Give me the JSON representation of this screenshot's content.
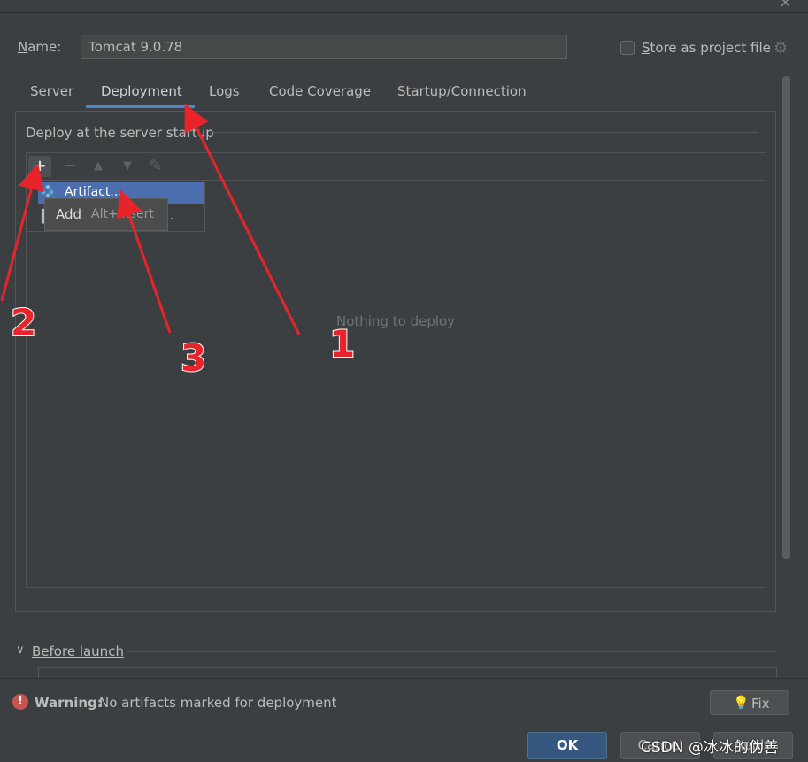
{
  "header": {
    "name_label_letter": "N",
    "name_label_rest": "ame:",
    "name_value": "Tomcat 9.0.78",
    "store_label_letter": "S",
    "store_label_rest": "tore as project file",
    "store_checked": false
  },
  "tabs": [
    {
      "label": "Server",
      "active": false
    },
    {
      "label": "Deployment",
      "active": true
    },
    {
      "label": "Logs",
      "active": false
    },
    {
      "label": "Code Coverage",
      "active": false
    },
    {
      "label": "Startup/Connection",
      "active": false
    }
  ],
  "deploy": {
    "section_title": "Deploy at the server startup",
    "empty_text": "Nothing to deploy",
    "toolbar": [
      "plus-icon",
      "minus-icon",
      "arrow-up-icon",
      "arrow-down-icon",
      "pencil-icon"
    ]
  },
  "add_popup": {
    "item1": "Artifact...",
    "item2_dots": ".."
  },
  "tooltip": {
    "label": "Add",
    "shortcut": "Alt+Insert"
  },
  "before_launch": {
    "letter": "B",
    "rest": "efore launch"
  },
  "warning": {
    "bold": "Warning:",
    "text": "No artifacts marked for deployment"
  },
  "buttons": {
    "fix": "Fix",
    "ok": "OK",
    "cancel": "Cancel",
    "apply": "Apply"
  },
  "annotations": {
    "one": "1",
    "two": "2",
    "three": "3"
  },
  "watermark": "CSDN @冰冰的伪善",
  "colors": {
    "background": "#3c3f41",
    "accent": "#4a88c7",
    "selection": "#4b6eaf",
    "primary_button": "#365880",
    "error": "#c75450",
    "annotation": "#e8232a"
  }
}
